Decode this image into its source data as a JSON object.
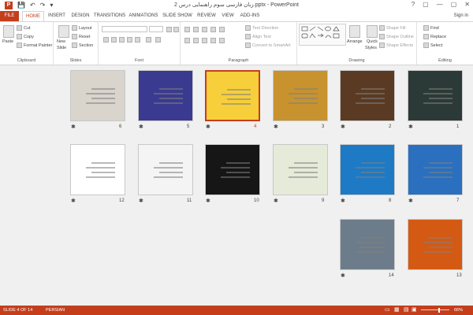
{
  "app": {
    "window_title": "زبان فارسی سوم راهنمایی درس 2.pptx - PowerPoint",
    "sign_in": "Sign in",
    "window_controls": [
      "?",
      "▢",
      "—",
      "▢",
      "✕"
    ]
  },
  "qat": [
    "P",
    "💾",
    "↶",
    "↷",
    "▾"
  ],
  "tabs": [
    "FILE",
    "HOME",
    "INSERT",
    "DESIGN",
    "TRANSITIONS",
    "ANIMATIONS",
    "SLIDE SHOW",
    "REVIEW",
    "VIEW",
    "ADD-INS"
  ],
  "active_tab": "HOME",
  "ribbon": {
    "clipboard": {
      "label": "Clipboard",
      "paste": "Paste",
      "cut": "Cut",
      "copy": "Copy",
      "format_painter": "Format Painter"
    },
    "slides": {
      "label": "Slides",
      "new_slide": "New",
      "new_slide_2": "Slide",
      "layout": "Layout",
      "reset": "Reset",
      "section": "Section"
    },
    "font": {
      "label": "Font"
    },
    "paragraph": {
      "label": "Paragraph",
      "text_direction": "Text Direction",
      "align_text": "Align Text",
      "convert": "Convert to SmartArt"
    },
    "drawing": {
      "label": "Drawing",
      "arrange": "Arrange",
      "quick_styles": "Quick",
      "quick_styles_2": "Styles",
      "shape_fill": "Shape Fill",
      "shape_outline": "Shape Outline",
      "shape_effects": "Shape Effects"
    },
    "editing": {
      "label": "Editing",
      "find": "Find",
      "replace": "Replace",
      "select": "Select"
    }
  },
  "slides": [
    {
      "num": "1",
      "star": "✱",
      "bg": "#2b3a36"
    },
    {
      "num": "2",
      "star": "✱",
      "bg": "#5a3a22"
    },
    {
      "num": "3",
      "star": "✱",
      "bg": "#c8922e"
    },
    {
      "num": "4",
      "star": "✱",
      "bg": "#f6cf3a"
    },
    {
      "num": "5",
      "star": "✱",
      "bg": "#3a3a90"
    },
    {
      "num": "6",
      "star": "✱",
      "bg": "#d9d4cc"
    },
    {
      "num": "7",
      "star": "✱",
      "bg": "#2b6fbf"
    },
    {
      "num": "8",
      "star": "✱",
      "bg": "#1e7ac4"
    },
    {
      "num": "9",
      "star": "✱",
      "bg": "#e6ead8"
    },
    {
      "num": "10",
      "star": "✱",
      "bg": "#161616"
    },
    {
      "num": "11",
      "star": "✱",
      "bg": "#f4f4f4"
    },
    {
      "num": "12",
      "star": "✱",
      "bg": "#ffffff"
    },
    {
      "num": "13",
      "star": "",
      "bg": "#d45a14"
    },
    {
      "num": "14",
      "star": "✱",
      "bg": "#6d7c8a"
    }
  ],
  "selected_slide": "4",
  "status": {
    "slide": "SLIDE 4 OF 14",
    "language": "PERSIAN",
    "zoom": "66%"
  },
  "colors": {
    "accent": "#c43e1c"
  }
}
